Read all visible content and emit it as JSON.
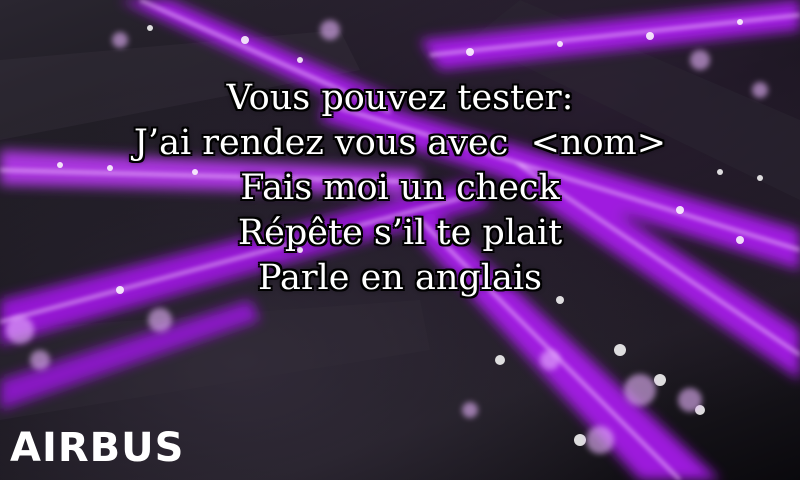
{
  "prompt": {
    "lines": [
      "Vous pouvez tester:",
      "J’ai rendez vous avec  <nom>",
      "Fais moi un check",
      "Répête s’il te plait",
      "Parle en anglais"
    ]
  },
  "brand": {
    "logo_text": "AIRBUS"
  },
  "background": {
    "beam_color": "#b51dff",
    "beam_glow": "#d86bff",
    "dark_base": "#121016"
  }
}
